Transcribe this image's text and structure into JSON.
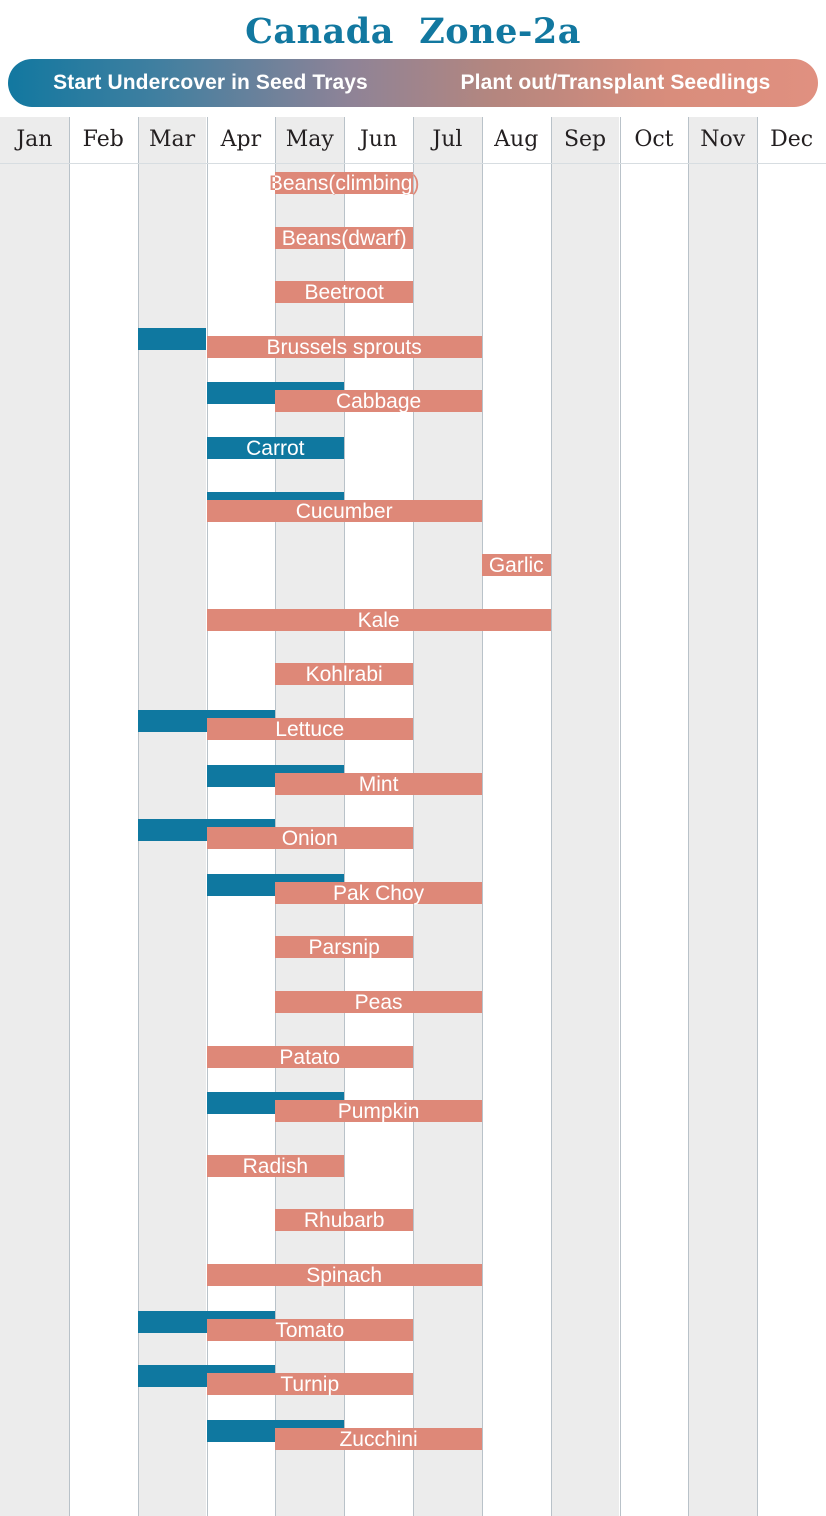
{
  "title": "Canada  Zone-2a",
  "legend": {
    "sow_label": "Start Undercover in Seed Trays",
    "plant_label": "Plant out/Transplant Seedlings",
    "sow_color": "#0f78a0",
    "plant_color": "#de8878"
  },
  "months": [
    "Jan",
    "Feb",
    "Mar",
    "Apr",
    "May",
    "Jun",
    "Jul",
    "Aug",
    "Sep",
    "Oct",
    "Nov",
    "Dec"
  ],
  "chart_data": {
    "type": "bar",
    "title": "Canada  Zone-2a",
    "xlabel": "",
    "ylabel": "",
    "categories": [
      "Jan",
      "Feb",
      "Mar",
      "Apr",
      "May",
      "Jun",
      "Jul",
      "Aug",
      "Sep",
      "Oct",
      "Nov",
      "Dec"
    ],
    "legend_position": "top",
    "grid": true,
    "series": [
      {
        "name": "Start Undercover in Seed Trays",
        "color": "#0f78a0"
      },
      {
        "name": "Plant out/Transplant Seedlings",
        "color": "#de8878"
      }
    ],
    "rows": [
      {
        "crop": "Beans(climbing)",
        "sow": null,
        "plant": [
          "May",
          "Jun"
        ]
      },
      {
        "crop": "Beans(dwarf)",
        "sow": null,
        "plant": [
          "May",
          "Jun"
        ]
      },
      {
        "crop": "Beetroot",
        "sow": null,
        "plant": [
          "May",
          "Jun"
        ]
      },
      {
        "crop": "Brussels sprouts",
        "sow": [
          "Mar",
          "Mar"
        ],
        "plant": [
          "Apr",
          "Jul"
        ]
      },
      {
        "crop": "Cabbage",
        "sow": [
          "Apr",
          "May"
        ],
        "plant": [
          "May",
          "Jul"
        ]
      },
      {
        "crop": "Carrot",
        "sow": [
          "Apr",
          "May"
        ],
        "plant": null
      },
      {
        "crop": "Cucumber",
        "sow": [
          "Apr",
          "May"
        ],
        "plant": [
          "Apr",
          "Jul"
        ]
      },
      {
        "crop": "Garlic",
        "sow": null,
        "plant": [
          "Aug",
          "Aug"
        ]
      },
      {
        "crop": "Kale",
        "sow": null,
        "plant": [
          "Apr",
          "Aug"
        ]
      },
      {
        "crop": "Kohlrabi",
        "sow": null,
        "plant": [
          "May",
          "Jun"
        ]
      },
      {
        "crop": "Lettuce",
        "sow": [
          "Mar",
          "Apr"
        ],
        "plant": [
          "Apr",
          "Jun"
        ]
      },
      {
        "crop": "Mint",
        "sow": [
          "Apr",
          "May"
        ],
        "plant": [
          "May",
          "Jul"
        ]
      },
      {
        "crop": "Onion",
        "sow": [
          "Mar",
          "Apr"
        ],
        "plant": [
          "Apr",
          "Jun"
        ]
      },
      {
        "crop": "Pak Choy",
        "sow": [
          "Apr",
          "May"
        ],
        "plant": [
          "May",
          "Jul"
        ]
      },
      {
        "crop": "Parsnip",
        "sow": null,
        "plant": [
          "May",
          "Jun"
        ]
      },
      {
        "crop": "Peas",
        "sow": null,
        "plant": [
          "May",
          "Jul"
        ]
      },
      {
        "crop": "Patato",
        "sow": null,
        "plant": [
          "Apr",
          "Jun"
        ]
      },
      {
        "crop": "Pumpkin",
        "sow": [
          "Apr",
          "May"
        ],
        "plant": [
          "May",
          "Jul"
        ]
      },
      {
        "crop": "Radish",
        "sow": null,
        "plant": [
          "Apr",
          "May"
        ]
      },
      {
        "crop": "Rhubarb",
        "sow": null,
        "plant": [
          "May",
          "Jun"
        ]
      },
      {
        "crop": "Spinach",
        "sow": null,
        "plant": [
          "Apr",
          "Jul"
        ]
      },
      {
        "crop": "Tomato",
        "sow": [
          "Mar",
          "Apr"
        ],
        "plant": [
          "Apr",
          "Jun"
        ]
      },
      {
        "crop": "Turnip",
        "sow": [
          "Mar",
          "Apr"
        ],
        "plant": [
          "Apr",
          "Jun"
        ]
      },
      {
        "crop": "Zucchini",
        "sow": [
          "Apr",
          "May"
        ],
        "plant": [
          "May",
          "Jul"
        ]
      }
    ]
  }
}
